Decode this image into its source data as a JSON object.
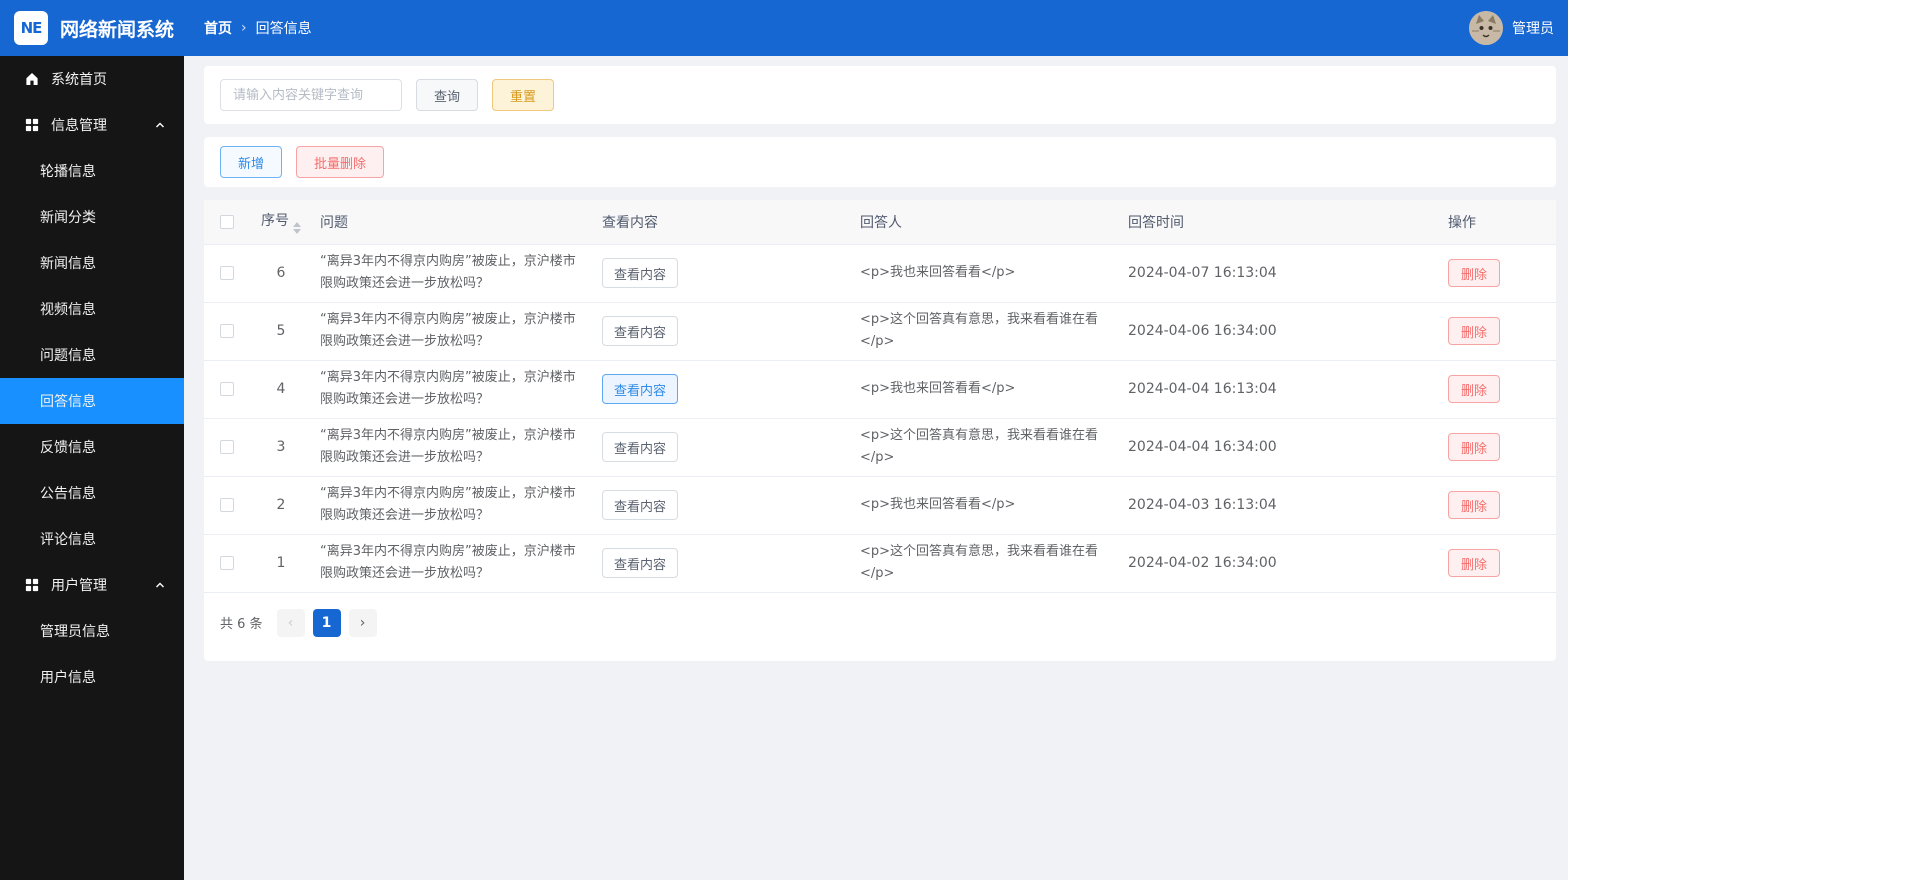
{
  "header": {
    "logo_text": "NE",
    "app_title": "网络新闻系统",
    "breadcrumb": {
      "home": "首页",
      "separator": "›",
      "current": "回答信息"
    },
    "user_name": "管理员"
  },
  "sidebar": {
    "home_label": "系统首页",
    "active_item": "回答信息",
    "groups": [
      {
        "label": "信息管理",
        "children": [
          "轮播信息",
          "新闻分类",
          "新闻信息",
          "视频信息",
          "问题信息",
          "回答信息",
          "反馈信息",
          "公告信息",
          "评论信息"
        ]
      },
      {
        "label": "用户管理",
        "children": [
          "管理员信息",
          "用户信息"
        ]
      }
    ]
  },
  "search": {
    "placeholder": "请输入内容关键字查询",
    "query_label": "查询",
    "reset_label": "重置"
  },
  "toolbar": {
    "add_label": "新增",
    "batch_delete_label": "批量删除"
  },
  "table": {
    "headers": [
      "序号",
      "问题",
      "查看内容",
      "回答人",
      "回答时间",
      "操作"
    ],
    "view_label": "查看内容",
    "delete_label": "删除",
    "rows": [
      {
        "no": "6",
        "question": "“离异3年内不得京内购房”被废止，京沪楼市限购政策还会进一步放松吗？",
        "answerer": "<p>我也来回答看看</p>",
        "time": "2024-04-07 16:13:04",
        "view_active": false
      },
      {
        "no": "5",
        "question": "“离异3年内不得京内购房”被废止，京沪楼市限购政策还会进一步放松吗？",
        "answerer": "<p>这个回答真有意思，我来看看谁在看</p>",
        "time": "2024-04-06 16:34:00",
        "view_active": false
      },
      {
        "no": "4",
        "question": "“离异3年内不得京内购房”被废止，京沪楼市限购政策还会进一步放松吗？",
        "answerer": "<p>我也来回答看看</p>",
        "time": "2024-04-04 16:13:04",
        "view_active": true
      },
      {
        "no": "3",
        "question": "“离异3年内不得京内购房”被废止，京沪楼市限购政策还会进一步放松吗？",
        "answerer": "<p>这个回答真有意思，我来看看谁在看</p>",
        "time": "2024-04-04 16:34:00",
        "view_active": false
      },
      {
        "no": "2",
        "question": "“离异3年内不得京内购房”被废止，京沪楼市限购政策还会进一步放松吗？",
        "answerer": "<p>我也来回答看看</p>",
        "time": "2024-04-03 16:13:04",
        "view_active": false
      },
      {
        "no": "1",
        "question": "“离异3年内不得京内购房”被废止，京沪楼市限购政策还会进一步放松吗？",
        "answerer": "<p>这个回答真有意思，我来看看谁在看</p>",
        "time": "2024-04-02 16:34:00",
        "view_active": false
      }
    ]
  },
  "pagination": {
    "total_label": "共 6 条",
    "prev_icon": "‹",
    "page": "1",
    "next_icon": "›"
  }
}
